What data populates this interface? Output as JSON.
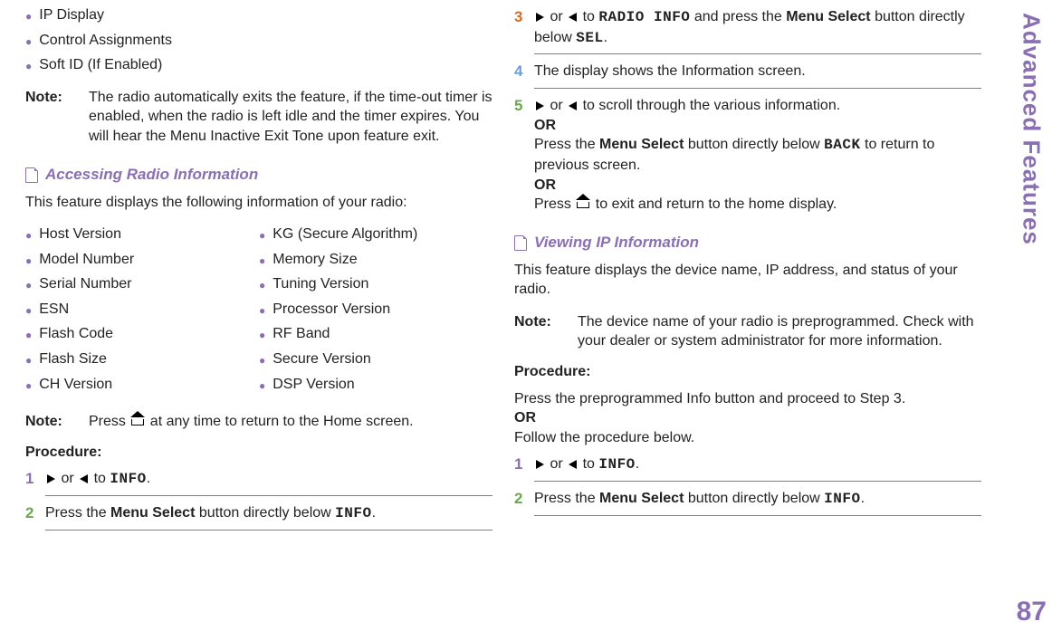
{
  "side": {
    "title": "Advanced Features",
    "pageNumber": "87"
  },
  "left": {
    "topBullets": [
      "IP Display",
      "Control Assignments",
      "Soft ID (If Enabled)"
    ],
    "note1Label": "Note:",
    "note1Text": "The radio automatically exits the feature, if the time-out timer is enabled, when the radio is left idle and the timer expires. You will hear the Menu Inactive Exit Tone upon feature exit.",
    "section1": "Accessing Radio Information",
    "section1Intro": "This feature displays the following information of your radio:",
    "infoListLeft": [
      "Host Version",
      "Model Number",
      "Serial Number",
      "ESN",
      "Flash Code",
      "Flash Size",
      "CH Version"
    ],
    "infoListRight": [
      "KG (Secure Algorithm)",
      "Memory Size",
      "Tuning Version",
      "Processor Version",
      "RF Band",
      "Secure Version",
      "DSP Version"
    ],
    "note2Label": "Note:",
    "note2a": "Press ",
    "note2b": " at any time to return to the Home screen.",
    "procLabel": "Procedure:",
    "step1": {
      "num": "1",
      "or": " or ",
      "to": " to ",
      "target": "INFO",
      "dot": "."
    },
    "step2": {
      "num": "2",
      "a": "Press the ",
      "b": "Menu Select",
      "c": " button directly below ",
      "d": "INFO",
      "e": "."
    }
  },
  "right": {
    "step3": {
      "num": "3",
      "or": " or ",
      "to": " to ",
      "target": "RADIO INFO",
      "mid": " and press the ",
      "b": "Menu Select",
      "c": " button directly below ",
      "d": "SEL",
      "e": "."
    },
    "step4": {
      "num": "4",
      "text": "The display shows the Information screen."
    },
    "step5": {
      "num": "5",
      "or": " or ",
      "rest": " to scroll through the various information.",
      "or1": "OR",
      "line2a": "Press the ",
      "line2b": "Menu Select",
      "line2c": " button directly below ",
      "line2d": "BACK",
      "line2e": " to return to previous screen.",
      "or2": "OR",
      "line3a": "Press ",
      "line3b": " to exit and return to the home display."
    },
    "section2": "Viewing IP Information",
    "section2Intro": "This feature displays the device name, IP address, and status of your radio.",
    "note3Label": "Note:",
    "note3Text": "The device name of your radio is preprogrammed. Check with your dealer or system administrator for more information.",
    "procLabel": "Procedure:",
    "procIntro1": "Press the preprogrammed Info button and proceed to Step 3.",
    "procOr": "OR",
    "procIntro2": "Follow the procedure below.",
    "step1": {
      "num": "1",
      "or": " or ",
      "to": " to ",
      "target": "INFO",
      "dot": "."
    },
    "step2": {
      "num": "2",
      "a": "Press the ",
      "b": "Menu Select",
      "c": " button directly below ",
      "d": "INFO",
      "e": "."
    }
  }
}
